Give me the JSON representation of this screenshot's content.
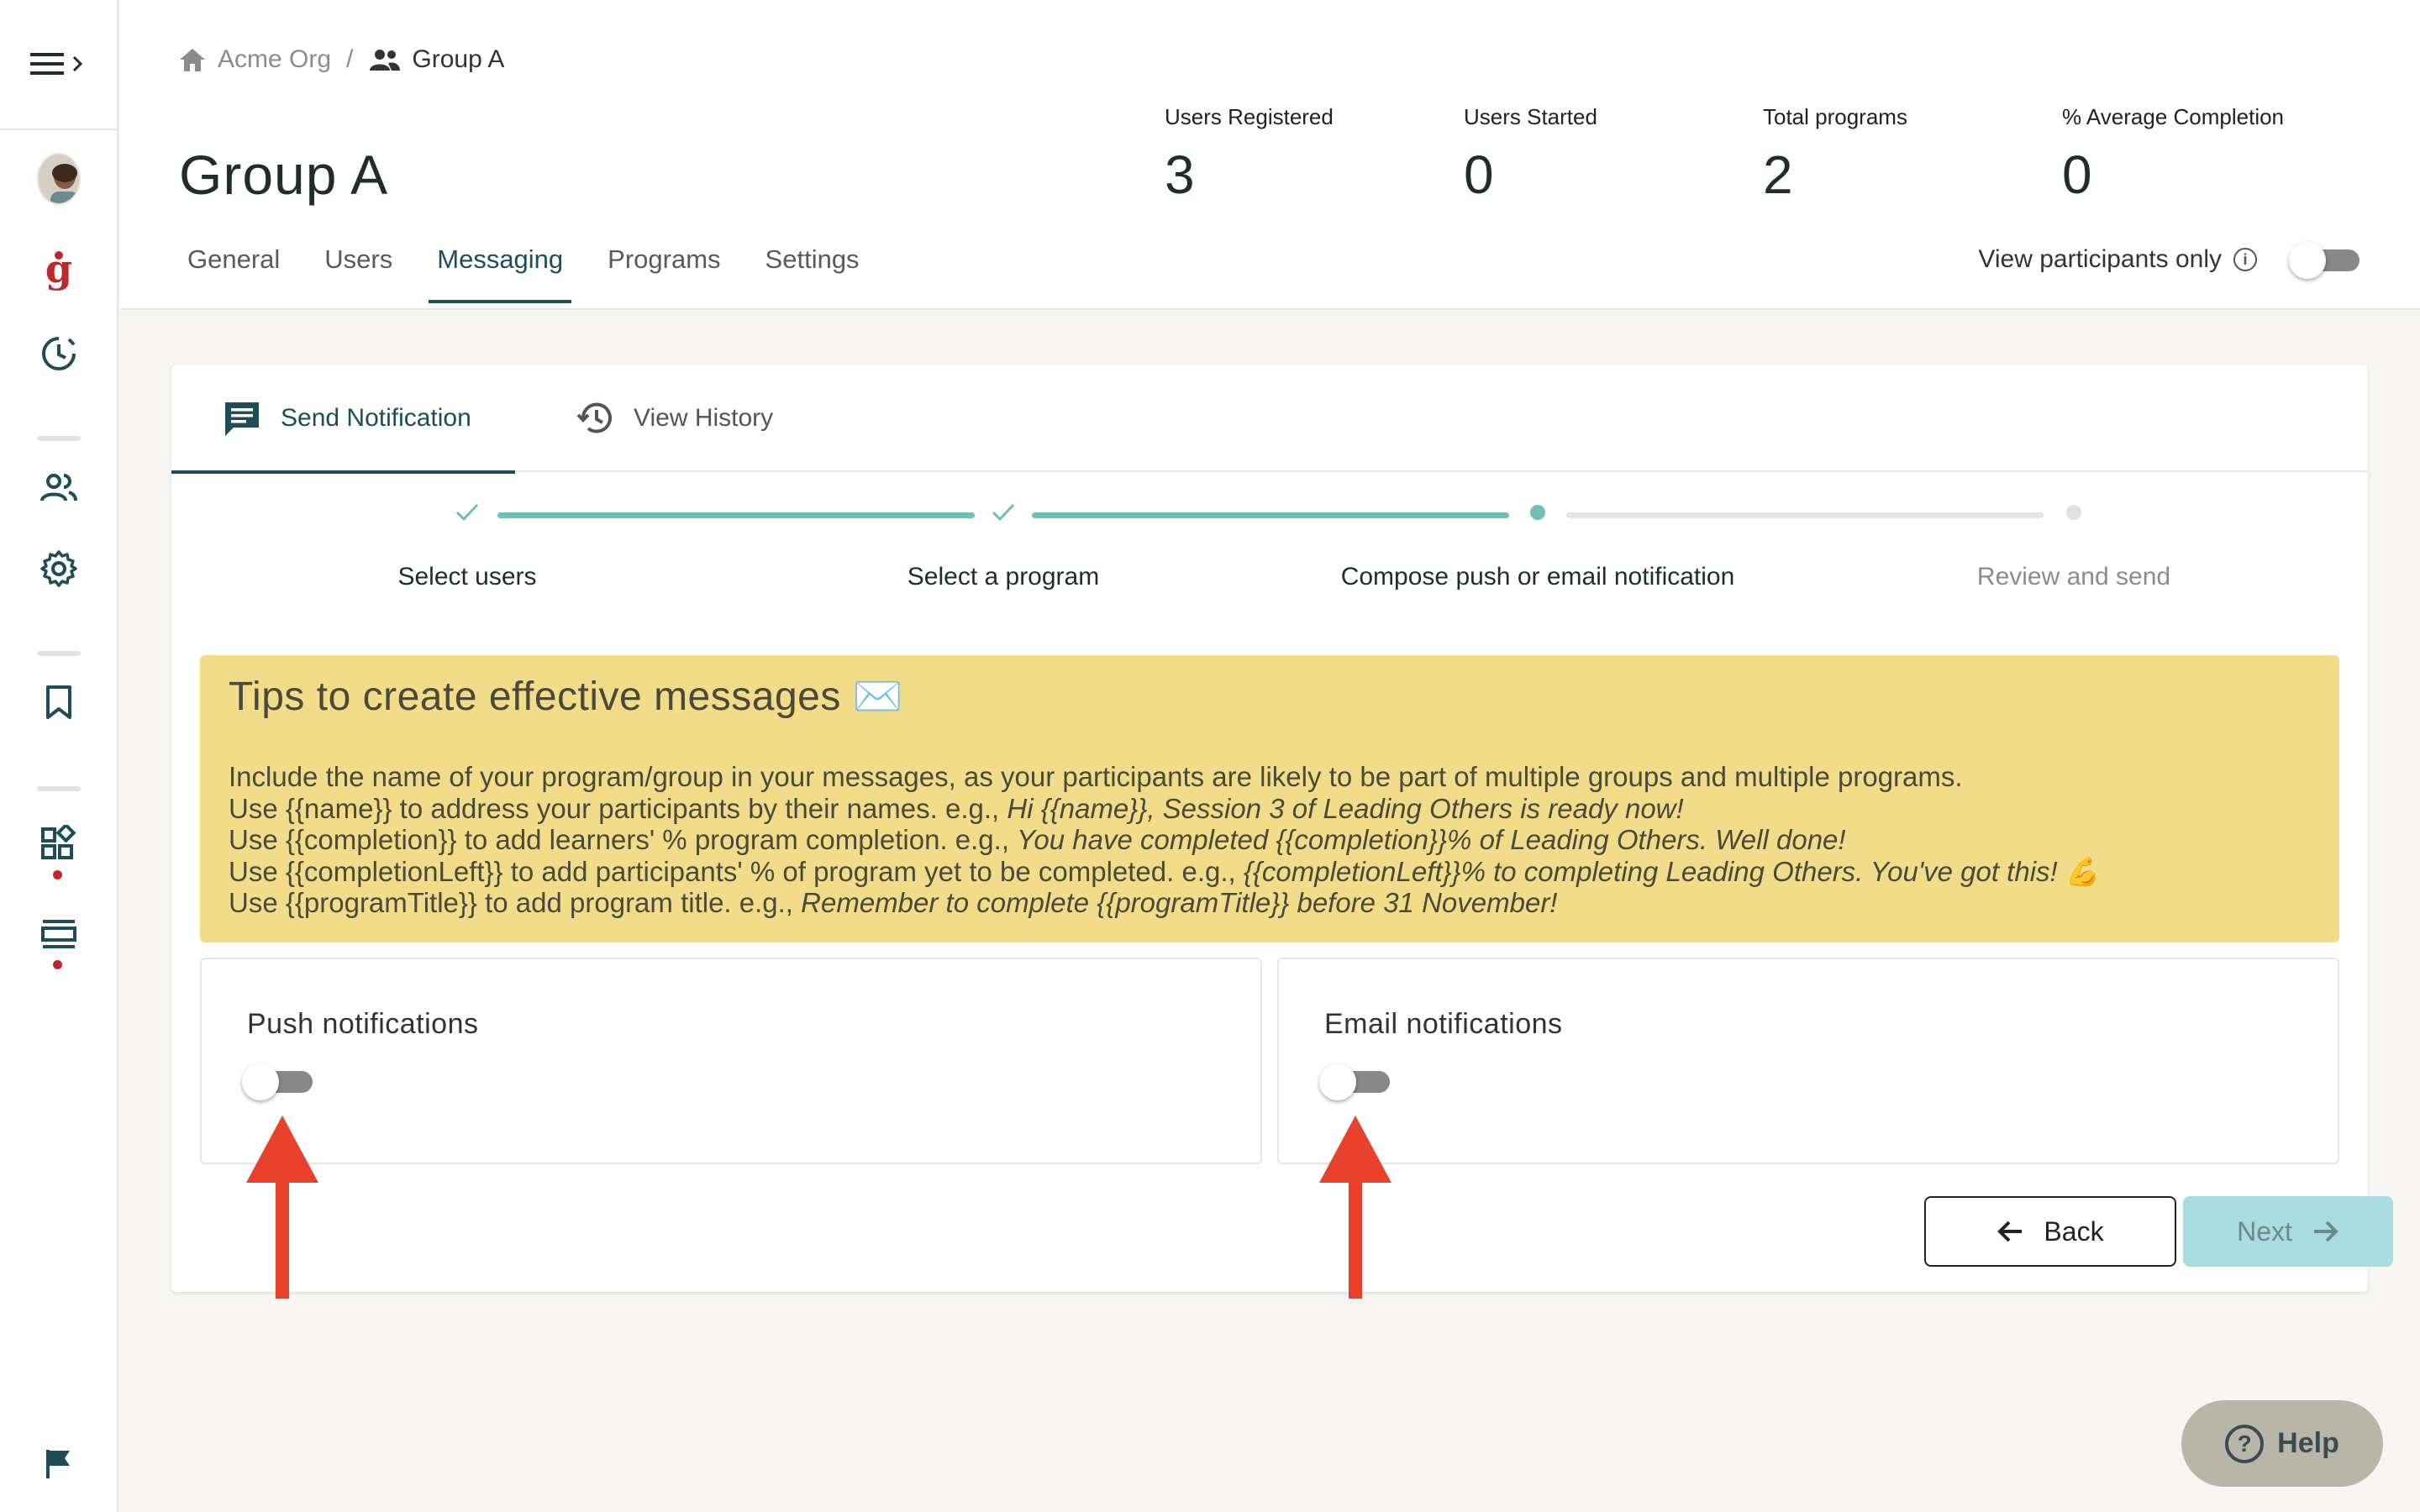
{
  "breadcrumb": {
    "org": "Acme Org",
    "separator": "/",
    "group": "Group A"
  },
  "page": {
    "title": "Group A"
  },
  "stats": [
    {
      "label": "Users Registered",
      "value": "3"
    },
    {
      "label": "Users Started",
      "value": "0"
    },
    {
      "label": "Total programs",
      "value": "2"
    },
    {
      "label": "% Average Completion",
      "value": "0"
    }
  ],
  "tabs": [
    {
      "label": "General",
      "active": false
    },
    {
      "label": "Users",
      "active": false
    },
    {
      "label": "Messaging",
      "active": true
    },
    {
      "label": "Programs",
      "active": false
    },
    {
      "label": "Settings",
      "active": false
    }
  ],
  "view_participants": {
    "label": "View participants only",
    "on": false
  },
  "subtabs": {
    "send": "Send Notification",
    "history": "View History"
  },
  "steps": [
    {
      "label": "Select users",
      "state": "done"
    },
    {
      "label": "Select a program",
      "state": "done"
    },
    {
      "label": "Compose push or email notification",
      "state": "current"
    },
    {
      "label": "Review and send",
      "state": "pending"
    }
  ],
  "tips": {
    "title": "Tips to create effective messages ✉️",
    "line1": "Include the name of your program/group in your messages, as your participants are likely to be part of multiple groups and multiple programs.",
    "line2_plain": "Use {{name}} to address your participants by their names. e.g., ",
    "line2_italic": "Hi {{name}}, Session 3 of Leading Others is ready now!",
    "line3_plain": "Use {{completion}} to add learners' % program completion. e.g., ",
    "line3_italic": "You have completed {{completion}}% of Leading Others. Well done!",
    "line4_plain": "Use {{completionLeft}} to add participants' % of program yet to be completed. e.g., ",
    "line4_italic": "{{completionLeft}}% to completing Leading Others. You've got this! 💪",
    "line5_plain": "Use {{programTitle}} to add program title. e.g., ",
    "line5_italic": "Remember to complete {{programTitle}} before 31 November!"
  },
  "push": {
    "title": "Push notifications",
    "on": false
  },
  "email": {
    "title": "Email notifications",
    "on": false
  },
  "buttons": {
    "back": "Back",
    "next": "Next"
  },
  "help": {
    "label": "Help"
  },
  "colors": {
    "teal_dark": "#1d4e57",
    "teal_light": "#6fbfb7",
    "tips_bg": "#f2dc8a",
    "arrow_red": "#e8412c",
    "brand_red": "#c0272d"
  }
}
